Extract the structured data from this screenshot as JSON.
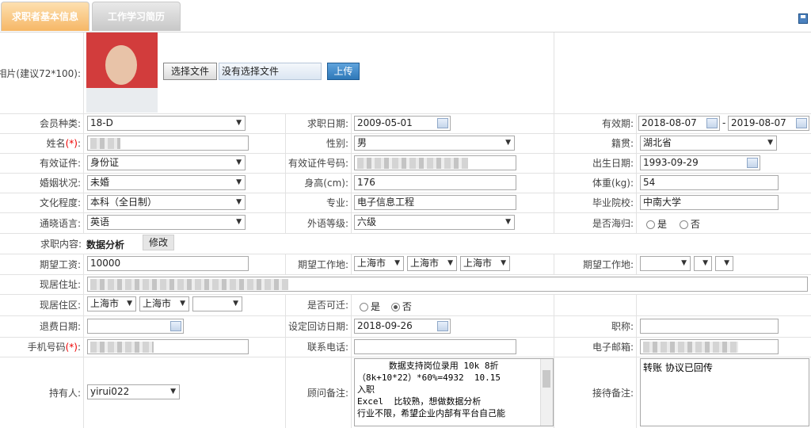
{
  "tabs": [
    {
      "label": "求职者基本信息"
    },
    {
      "label": "工作学习简历"
    }
  ],
  "photo": {
    "label": "相片(建议72*100):",
    "choose_button": "选择文件",
    "no_file": "没有选择文件",
    "upload_button": "上传"
  },
  "member_type": {
    "label": "会员种类:",
    "value": "18-D"
  },
  "job_date": {
    "label": "求职日期:",
    "value": "2009-05-01"
  },
  "valid_period": {
    "label": "有效期:",
    "start": "2018-08-07",
    "sep": "-",
    "end": "2019-08-07"
  },
  "name": {
    "label": "姓名",
    "req": "(*)",
    "colon": ":"
  },
  "gender": {
    "label": "性别:",
    "value": "男"
  },
  "hometown": {
    "label": "籍贯:",
    "value": "湖北省"
  },
  "id_type": {
    "label": "有效证件:",
    "value": "身份证"
  },
  "id_number": {
    "label": "有效证件号码:"
  },
  "birth": {
    "label": "出生日期:",
    "value": "1993-09-29"
  },
  "marital": {
    "label": "婚姻状况:",
    "value": "未婚"
  },
  "height": {
    "label": "身高(cm):",
    "value": "176"
  },
  "weight": {
    "label": "体重(kg):",
    "value": "54"
  },
  "education": {
    "label": "文化程度:",
    "value": "本科（全日制）"
  },
  "major": {
    "label": "专业:",
    "value": "电子信息工程"
  },
  "school": {
    "label": "毕业院校:",
    "value": "中南大学"
  },
  "language": {
    "label": "通晓语言:",
    "value": "英语"
  },
  "foreign_level": {
    "label": "外语等级:",
    "value": "六级"
  },
  "overseas": {
    "label": "是否海归:",
    "yes": "是",
    "no": "否"
  },
  "job_content": {
    "label": "求职内容:",
    "value": "数据分析",
    "edit_button": "修改"
  },
  "salary": {
    "label": "期望工资:",
    "value": "10000"
  },
  "work_place1": {
    "label": "期望工作地:",
    "values": [
      "上海市",
      "上海市",
      "上海市"
    ]
  },
  "work_place2": {
    "label": "期望工作地:",
    "values": [
      "",
      "",
      ""
    ]
  },
  "address": {
    "label": "现居住址:"
  },
  "district": {
    "label": "现居住区:",
    "values": [
      "上海市",
      "上海市",
      ""
    ]
  },
  "relocate": {
    "label": "是否可迁:",
    "yes": "是",
    "no": "否"
  },
  "refund_date": {
    "label": "退费日期:"
  },
  "callback_date": {
    "label": "设定回访日期:",
    "value": "2018-09-26"
  },
  "title": {
    "label": "职称:"
  },
  "mobile": {
    "label": "手机号码",
    "req": "(*)",
    "colon": ":"
  },
  "phone": {
    "label": "联系电话:"
  },
  "email": {
    "label": "电子邮箱:"
  },
  "holder": {
    "label": "持有人:",
    "value": "yirui022"
  },
  "consultant_note": {
    "label": "顾问备注:",
    "value": "      数据支持岗位录用 10k 8折\n（8k+10*22）*60%=4932  10.15\n入职\nExcel  比较熟，想做数据分析\n行业不限，希望企业内部有平台自己能"
  },
  "reception_note": {
    "label": "接待备注:",
    "value": "转账 协议已回传"
  },
  "colors": {
    "tab_active": "#f6b766",
    "upload_btn": "#2e78b8",
    "border": "#e2e2e2"
  }
}
